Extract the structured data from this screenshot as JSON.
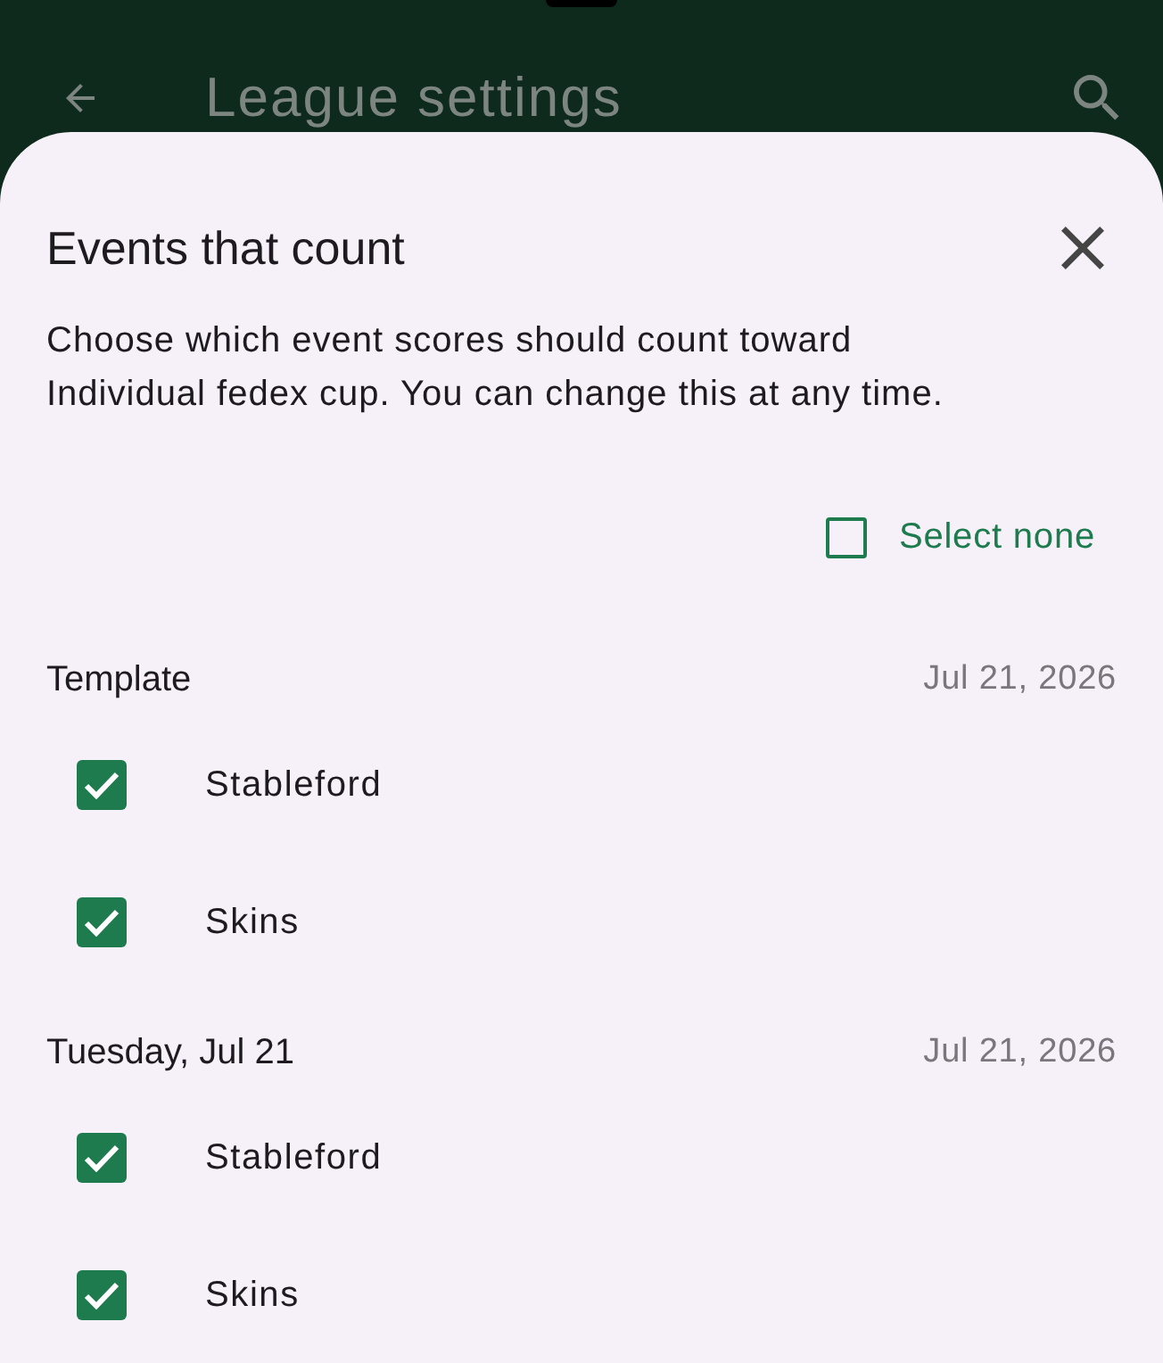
{
  "app_bar": {
    "title": "League settings"
  },
  "sheet": {
    "title": "Events that count",
    "description": "Choose which event scores should count toward Individual fedex cup. You can change this at any time.",
    "select_toggle": {
      "label": "Select none",
      "checked": false
    },
    "groups": [
      {
        "title": "Template",
        "date": "Jul 21, 2026",
        "events": [
          {
            "label": "Stableford",
            "checked": true
          },
          {
            "label": "Skins",
            "checked": true
          }
        ]
      },
      {
        "title": "Tuesday, Jul 21",
        "date": "Jul 21, 2026",
        "events": [
          {
            "label": "Stableford",
            "checked": true
          },
          {
            "label": "Skins",
            "checked": true
          }
        ]
      }
    ]
  }
}
